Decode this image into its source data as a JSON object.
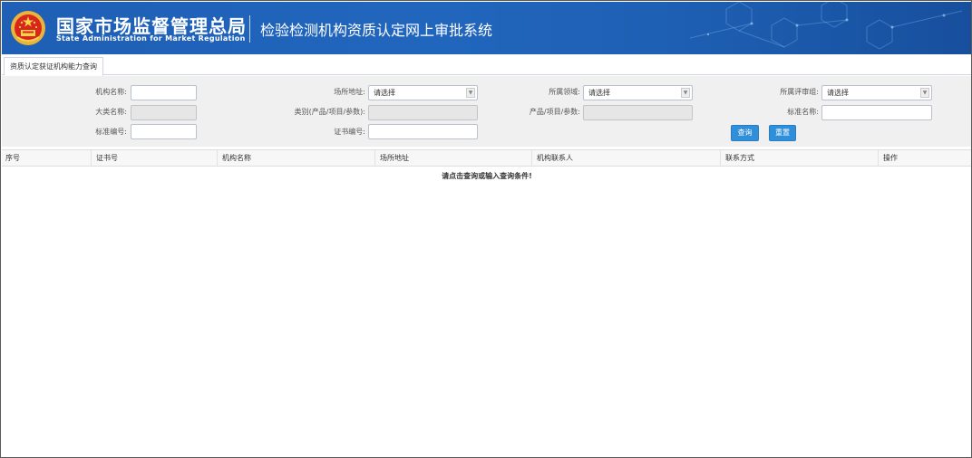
{
  "header": {
    "agency_cn": "国家市场监督管理总局",
    "agency_en": "State Administration  for  Market Regulation",
    "system_title": "检验检测机构资质认定网上审批系统",
    "bg_color": "#2166bd"
  },
  "tabs": [
    {
      "label": "资质认定获证机构能力查询",
      "active": true
    }
  ],
  "search": {
    "org_name_label": "机构名称:",
    "site_address_label": "场所地址:",
    "site_address_value": "请选择",
    "field_label": "所属领域:",
    "field_value": "请选择",
    "review_group_label": "所属评审组:",
    "review_group_value": "请选择",
    "major_category_label": "大类名称:",
    "category_label": "类别(产品/项目/参数):",
    "product_label": "产品/项目/参数:",
    "standard_name_label": "标准名称:",
    "standard_code_label": "标准编号:",
    "certificate_no_label": "证书编号:",
    "query_button": "查询",
    "reset_button": "重置",
    "button_color": "#2f8fd8"
  },
  "table": {
    "columns": [
      "序号",
      "证书号",
      "机构名称",
      "场所地址",
      "机构联系人",
      "联系方式",
      "操作"
    ],
    "rows": [],
    "empty_message": "请点击查询或输入查询条件!"
  }
}
